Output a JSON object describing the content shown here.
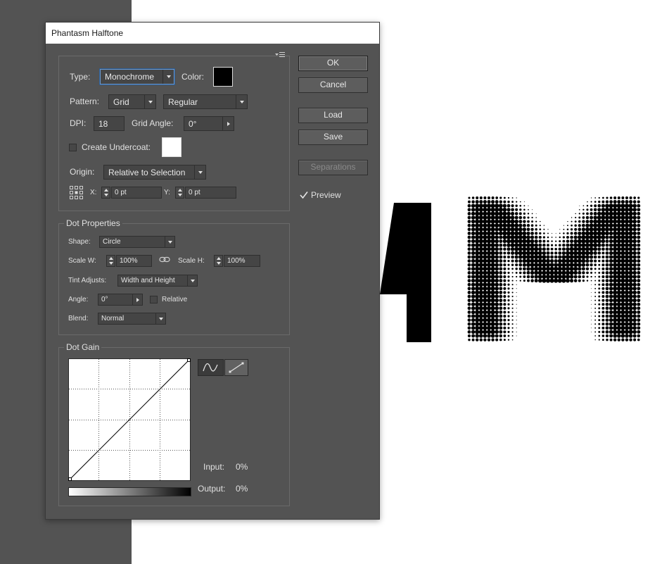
{
  "dialog": {
    "title": "Phantasm Halftone",
    "buttons": {
      "ok": "OK",
      "cancel": "Cancel",
      "load": "Load",
      "save": "Save",
      "separations": "Separations",
      "preview_label": "Preview",
      "preview_checked": true
    },
    "main": {
      "type_label": "Type:",
      "type_value": "Monochrome",
      "color_label": "Color:",
      "color_value": "#000000",
      "pattern_label": "Pattern:",
      "pattern_value": "Grid",
      "pattern_mode": "Regular",
      "dpi_label": "DPI:",
      "dpi_value": "18",
      "grid_angle_label": "Grid Angle:",
      "grid_angle_value": "0°",
      "undercoat_label": "Create Undercoat:",
      "undercoat_checked": false,
      "undercoat_color": "#ffffff",
      "origin_label": "Origin:",
      "origin_value": "Relative to Selection",
      "x_label": "X:",
      "x_value": "0 pt",
      "y_label": "Y:",
      "y_value": "0 pt"
    },
    "dot_properties": {
      "title": "Dot Properties",
      "shape_label": "Shape:",
      "shape_value": "Circle",
      "scale_w_label": "Scale W:",
      "scale_w_value": "100%",
      "scale_h_label": "Scale H:",
      "scale_h_value": "100%",
      "tint_label": "Tint Adjusts:",
      "tint_value": "Width and Height",
      "angle_label": "Angle:",
      "angle_value": "0°",
      "relative_label": "Relative",
      "relative_checked": false,
      "blend_label": "Blend:",
      "blend_value": "Normal"
    },
    "dot_gain": {
      "title": "Dot Gain",
      "input_label": "Input:",
      "input_value": "0%",
      "output_label": "Output:",
      "output_value": "0%"
    }
  },
  "canvas": {
    "letter": "M"
  }
}
